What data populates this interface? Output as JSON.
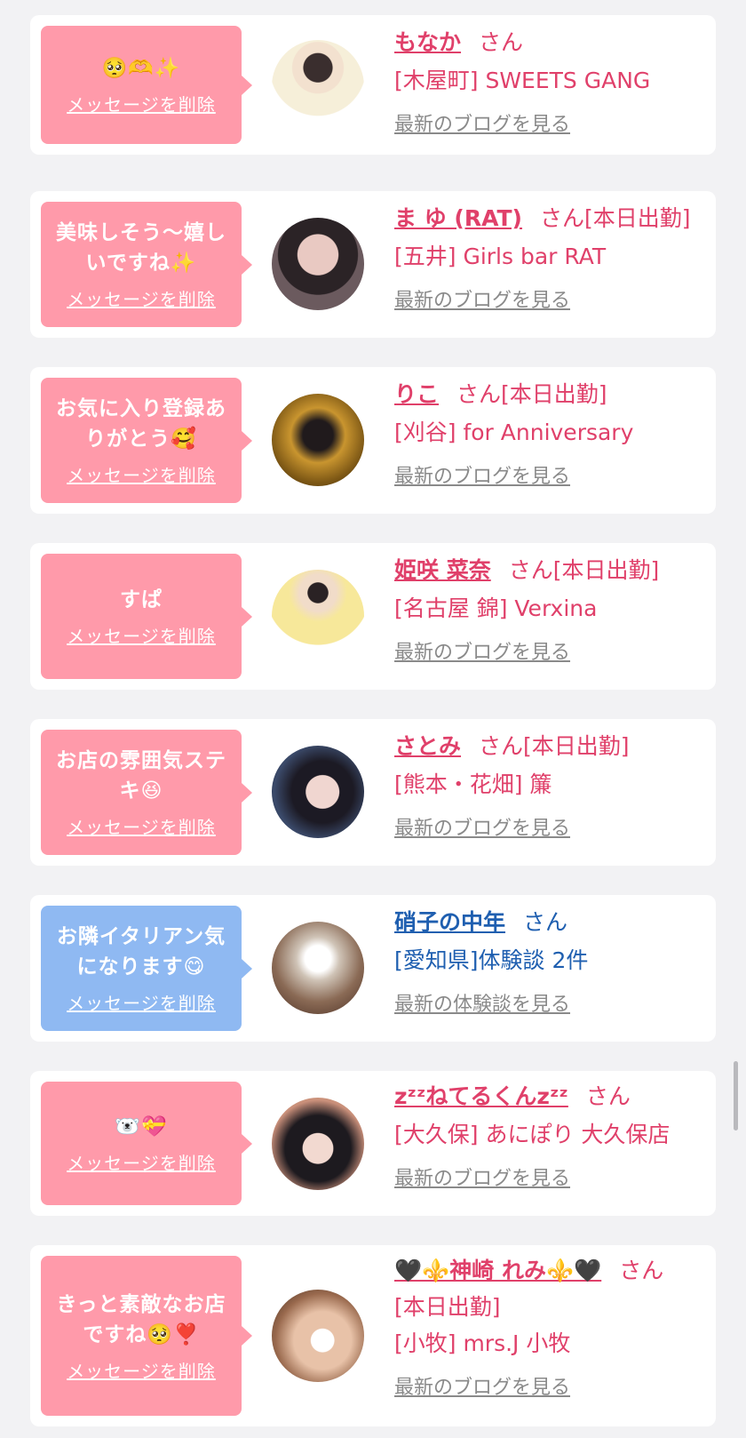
{
  "colors": {
    "pink_bubble": "#ff9aaa",
    "blue_bubble": "#8fb9f2",
    "accent_pink": "#e0406a",
    "accent_blue": "#1f5fb0"
  },
  "delete_label": "メッセージを削除",
  "items": [
    {
      "message": "🥺🫶✨",
      "name": "もなか",
      "san": "さん",
      "status": "",
      "shop": "[木屋町] SWEETS GANG",
      "link": "最新のブログを見る"
    },
    {
      "message": "美味しそう〜嬉しいですね✨",
      "name": "ま ゆ (RAT)",
      "san": "さん",
      "status": "[本日出勤]",
      "shop": "[五井] Girls bar RAT",
      "link": "最新のブログを見る"
    },
    {
      "message": "お気に入り登録ありがとう🥰",
      "name": "りこ",
      "san": "さん",
      "status": "[本日出勤]",
      "shop": "[刈谷] for Anniversary",
      "link": "最新のブログを見る"
    },
    {
      "message": "すぱ",
      "name": "姫咲 菜奈",
      "san": "さん",
      "status": "[本日出勤]",
      "shop": "[名古屋 錦] Verxina",
      "link": "最新のブログを見る"
    },
    {
      "message": "お店の雰囲気ステキ😆",
      "name": "さとみ",
      "san": "さん",
      "status": "[本日出勤]",
      "shop": "[熊本・花畑] 簾",
      "link": "最新のブログを見る"
    },
    {
      "message": "お隣イタリアン気になります😋",
      "name": "硝子の中年",
      "san": "さん",
      "status": "",
      "shop": "[愛知県]体験談 2件",
      "link": "最新の体験談を見る"
    },
    {
      "message": "🐻‍❄️💝",
      "name": "zᶻᶻねてるくんzᶻᶻ",
      "san": "さん",
      "status": "",
      "shop": "[大久保] あにぽり 大久保店",
      "link": "最新のブログを見る"
    },
    {
      "message": "きっと素敵なお店ですね🥺❣️",
      "name": "🖤⚜️神崎 れみ⚜️🖤",
      "san": "さん",
      "status": "[本日出勤]",
      "shop": "[小牧] mrs.J 小牧",
      "link": "最新のブログを見る"
    }
  ]
}
